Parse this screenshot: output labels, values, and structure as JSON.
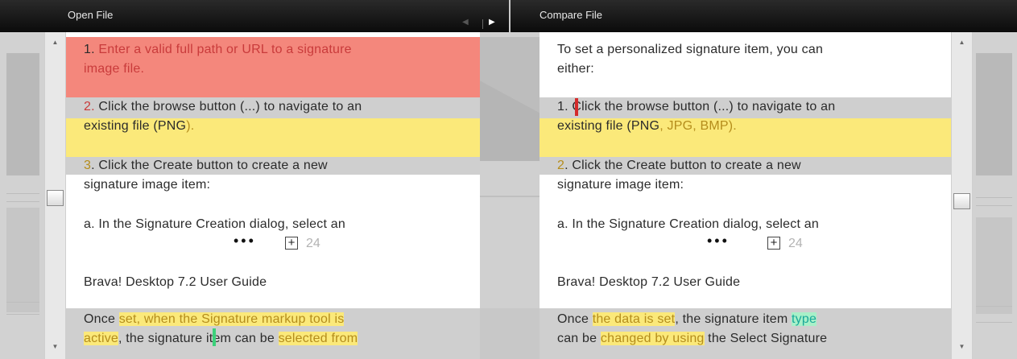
{
  "left_panel": {
    "title": "Open File",
    "lines": [
      {
        "t": "1. "
      },
      {
        "t": "Enter a valid full path or URL to a signature"
      },
      {
        "t": "image file."
      },
      {
        "t": "2. "
      },
      {
        "t": "Click the browse button (...) to navigate to an"
      },
      {
        "t": "existing file (PNG"
      },
      {
        "t": ")."
      },
      {
        "t": "3"
      },
      {
        "t": ". Click the Create button to create a new"
      },
      {
        "t": "signature image item:"
      },
      {
        "t": "a. In the Signature Creation dialog, select an"
      },
      {
        "t": "Brava! Desktop 7.2 User Guide"
      },
      {
        "t": "Once "
      },
      {
        "t": "set, when the Signature markup tool is"
      },
      {
        "t": "active"
      },
      {
        "t": ", the signature item "
      },
      {
        "t": "can be "
      },
      {
        "t": "selected from"
      }
    ],
    "page_number": "24",
    "dots": "•••"
  },
  "right_panel": {
    "title": "Compare File",
    "lines": [
      {
        "t": "To set a personalized signature item, you can"
      },
      {
        "t": "either:"
      },
      {
        "t": "1. "
      },
      {
        "t": "Click the browse button (...) to navigate to an"
      },
      {
        "t": "existing file  (PNG"
      },
      {
        "t": ", JPG, BMP)."
      },
      {
        "t": "2"
      },
      {
        "t": ". Click the Create button to create a new"
      },
      {
        "t": "signature image item:"
      },
      {
        "t": "a. In the Signature Creation dialog, select an"
      },
      {
        "t": "Brava! Desktop 7.2 User Guide"
      },
      {
        "t": "Once "
      },
      {
        "t": "the data is set"
      },
      {
        "t": ", the signature item "
      },
      {
        "t": "type"
      },
      {
        "t": "can be "
      },
      {
        "t": "changed by using"
      },
      {
        "t": " the Select Signature"
      }
    ],
    "page_number": "24",
    "dots": "•••"
  },
  "nav": {
    "prev_icon": "◀",
    "next_icon": "▶"
  },
  "scroll": {
    "up_icon": "▲",
    "down_icon": "▼",
    "expand_icon": "+"
  },
  "colors": {
    "deleted": "#f4877c",
    "changed": "#fbe97a",
    "moved": "#cfcfcf",
    "inserted": "#a8f0c8"
  }
}
